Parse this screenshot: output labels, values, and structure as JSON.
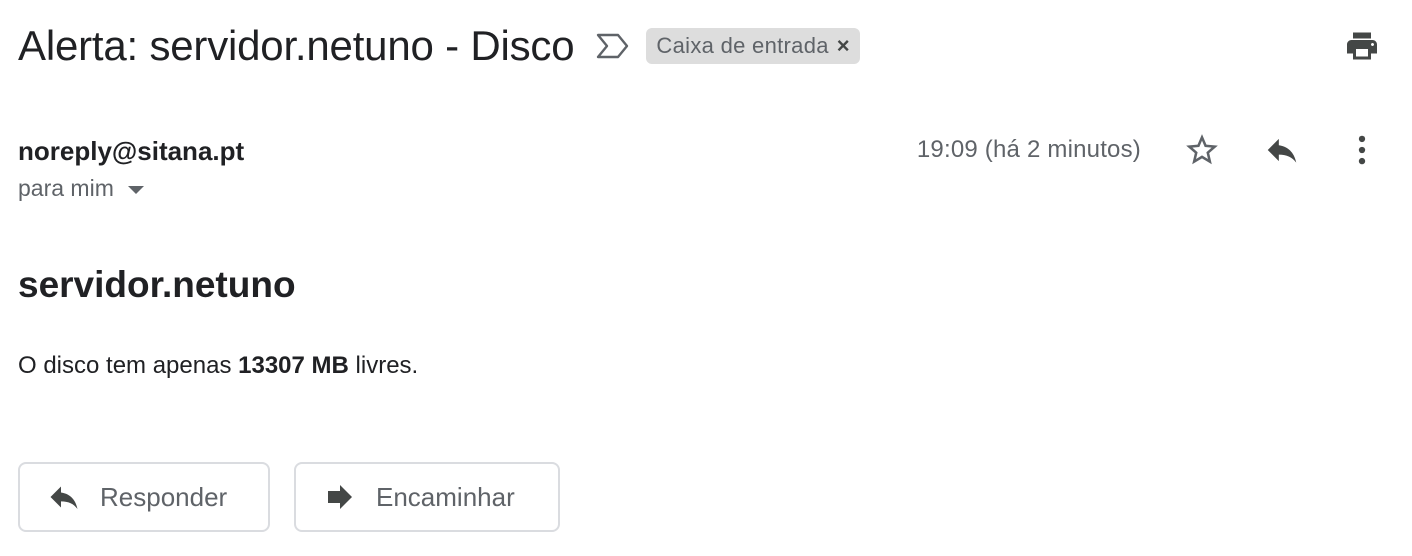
{
  "email": {
    "subject": "Alerta: servidor.netuno - Disco",
    "label": "Caixa de entrada",
    "label_close": "×",
    "sender": "noreply@sitana.pt",
    "recipient": "para mim",
    "timestamp": "19:09 (há 2 minutos)"
  },
  "body": {
    "heading": "servidor.netuno",
    "text_before": "O disco tem apenas",
    "text_bold": "13307 MB",
    "text_after": "livres."
  },
  "actions": {
    "reply_label": "Responder",
    "forward_label": "Encaminhar"
  },
  "icons": {
    "important_marker": "importance-marker-icon",
    "print": "print-icon",
    "star": "star-icon",
    "reply": "reply-icon",
    "more": "more-vert-icon",
    "recipient_dropdown": "chevron-down-icon",
    "forward": "forward-icon"
  },
  "colors": {
    "text_primary": "#202124",
    "text_secondary": "#5f6368",
    "chip_background": "#dddddd",
    "button_border": "#dadce0"
  }
}
